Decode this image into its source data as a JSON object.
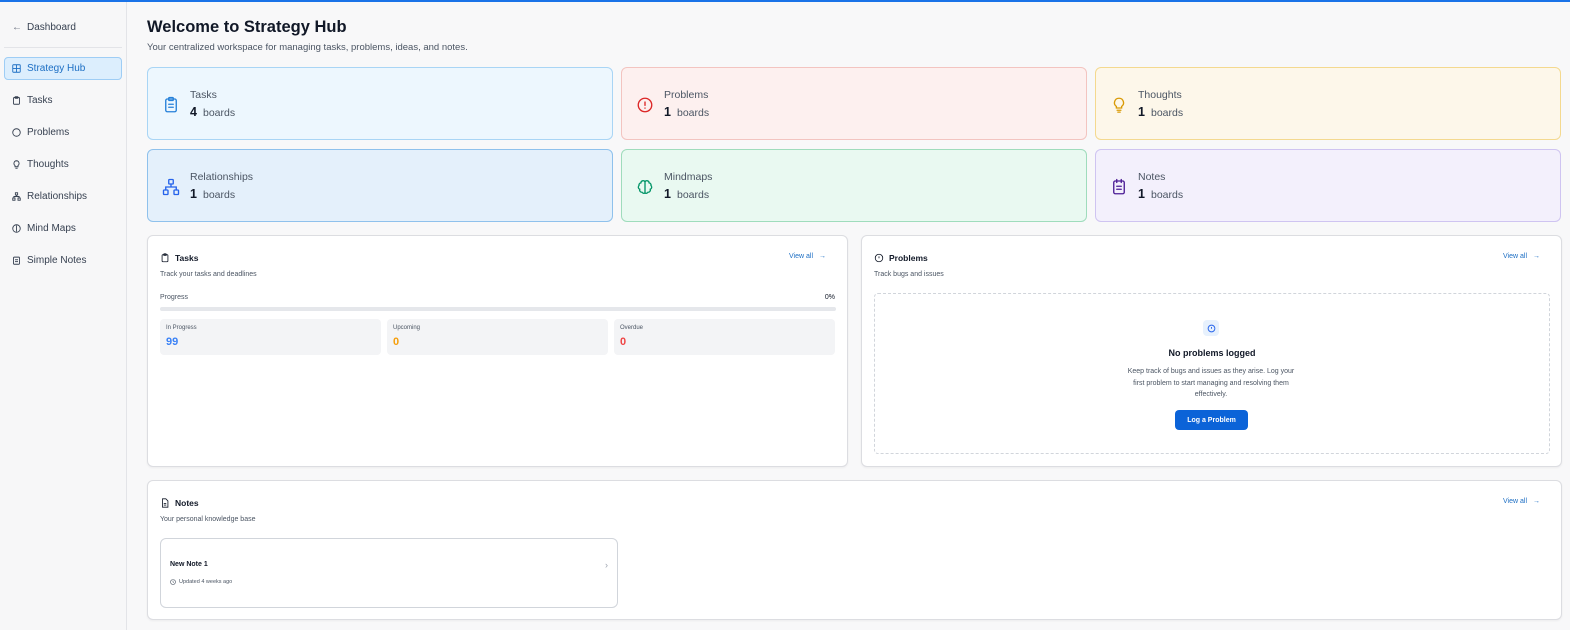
{
  "sidebar": {
    "back_label": "Dashboard",
    "items": [
      {
        "label": "Strategy Hub",
        "icon": "grid-icon",
        "active": true
      },
      {
        "label": "Tasks",
        "icon": "clipboard-icon"
      },
      {
        "label": "Problems",
        "icon": "circle-alert-icon"
      },
      {
        "label": "Thoughts",
        "icon": "lightbulb-icon"
      },
      {
        "label": "Relationships",
        "icon": "network-icon"
      },
      {
        "label": "Mind Maps",
        "icon": "brain-icon"
      },
      {
        "label": "Simple Notes",
        "icon": "notepad-icon"
      }
    ]
  },
  "header": {
    "title": "Welcome to Strategy Hub",
    "subtitle": "Your centralized workspace for managing tasks, problems, ideas, and notes."
  },
  "stats": [
    {
      "name": "Tasks",
      "count": "4",
      "unit": "boards",
      "icon": "clipboard-icon",
      "bg": "#edf7fe",
      "border": "#a9d5f5",
      "icon_color": "#2580d9"
    },
    {
      "name": "Problems",
      "count": "1",
      "unit": "boards",
      "icon": "circle-alert-icon",
      "bg": "#fdf0ef",
      "border": "#f3c4c0",
      "icon_color": "#dc2626"
    },
    {
      "name": "Thoughts",
      "count": "1",
      "unit": "boards",
      "icon": "lightbulb-icon",
      "bg": "#fdf7ea",
      "border": "#f4d98f",
      "icon_color": "#d99a06"
    },
    {
      "name": "Relationships",
      "count": "1",
      "unit": "boards",
      "icon": "network-icon",
      "bg": "#e4f0fb",
      "border": "#8fc1ec",
      "icon_color": "#2563eb"
    },
    {
      "name": "Mindmaps",
      "count": "1",
      "unit": "boards",
      "icon": "brain-icon",
      "bg": "#e9f9f1",
      "border": "#9fdcbc",
      "icon_color": "#059669"
    },
    {
      "name": "Notes",
      "count": "1",
      "unit": "boards",
      "icon": "notepad-icon",
      "bg": "#f3f0fc",
      "border": "#cfc4f1",
      "icon_color": "#4c1d95"
    }
  ],
  "tasks_panel": {
    "title": "Tasks",
    "subtitle": "Track your tasks and deadlines",
    "view_all": "View all",
    "progress_label": "Progress",
    "progress_value": "0%",
    "progress_fraction": 0,
    "stats": [
      {
        "label": "In Progress",
        "value": "99",
        "color": "#3b82f6"
      },
      {
        "label": "Upcoming",
        "value": "0",
        "color": "#f59e0b"
      },
      {
        "label": "Overdue",
        "value": "0",
        "color": "#ef4444"
      }
    ]
  },
  "problems_panel": {
    "title": "Problems",
    "subtitle": "Track bugs and issues",
    "view_all": "View all",
    "empty_title": "No problems logged",
    "empty_text": "Keep track of bugs and issues as they arise. Log your first problem to start managing and resolving them effectively.",
    "button": "Log a Problem"
  },
  "notes_panel": {
    "title": "Notes",
    "subtitle": "Your personal knowledge base",
    "view_all": "View all",
    "notes": [
      {
        "title": "New Note 1",
        "updated": "Updated 4 weeks ago"
      }
    ]
  }
}
